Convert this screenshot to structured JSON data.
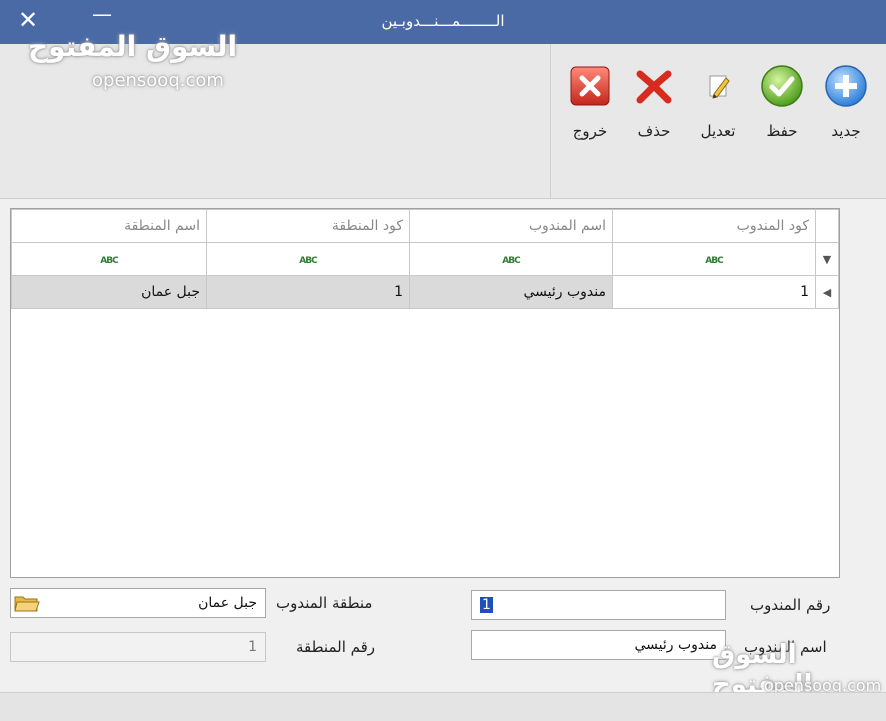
{
  "window": {
    "title": "الــــــــمـــنـــدوبـين"
  },
  "watermark": {
    "arabic": "السوق المفتوح",
    "latin": "opensooq.com"
  },
  "toolbar": {
    "new_label": "جديد",
    "save_label": "حفظ",
    "edit_label": "تعديل",
    "delete_label": "حذف",
    "exit_label": "خروج"
  },
  "grid": {
    "columns": [
      "كود المندوب",
      "اسم المندوب",
      "كود المنطقة",
      "اسم المنطقة"
    ],
    "filter_badge": "ABC",
    "rows": [
      {
        "agent_code": "1",
        "agent_name": "مندوب رئيسي",
        "region_code": "1",
        "region_name": "جبل عمان"
      }
    ]
  },
  "form": {
    "agent_number_label": "رقم المندوب",
    "agent_number_value": "1",
    "agent_name_label": "اسم المندوب",
    "agent_name_value": "مندوب رئيسي",
    "agent_region_label": "منطقة المندوب",
    "agent_region_value": "جبل عمان",
    "region_number_label": "رقم المنطقة",
    "region_number_value": "1"
  },
  "colors": {
    "titlebar": "#4a6aa6",
    "accent_select": "#1f4fb8"
  }
}
